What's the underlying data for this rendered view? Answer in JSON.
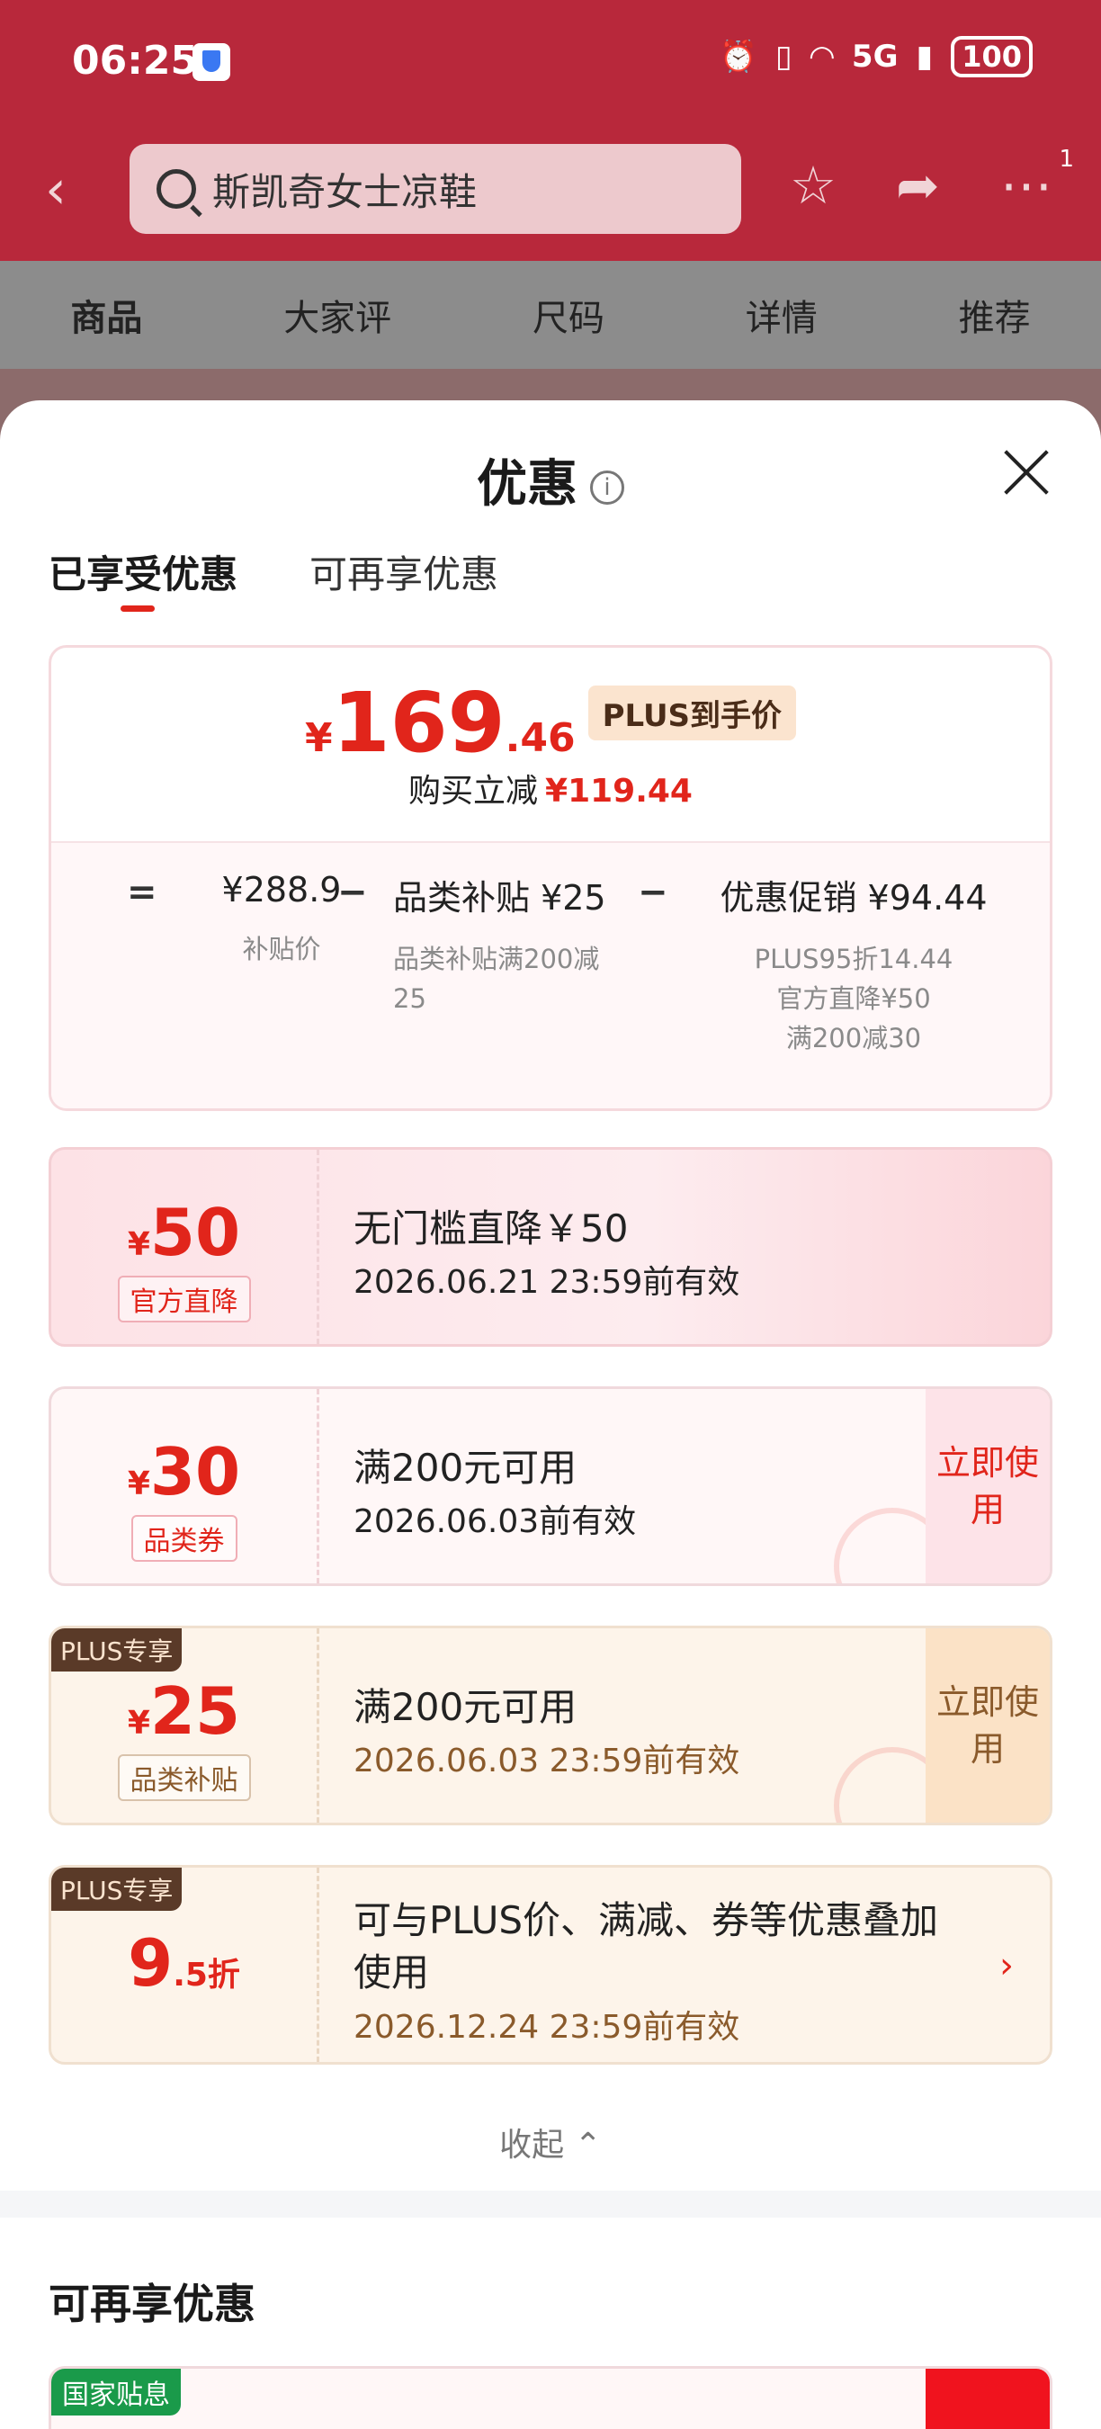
{
  "status_bar": {
    "time": "06:25",
    "network": "5G",
    "battery": "100"
  },
  "header": {
    "search_text": "斯凯奇女士凉鞋",
    "badge": "1",
    "tabs": [
      "商品",
      "大家评",
      "尺码",
      "详情",
      "推荐"
    ]
  },
  "sheet": {
    "title": "优惠",
    "subtabs": [
      "已享受优惠",
      "可再享优惠"
    ],
    "summary": {
      "yen": "¥",
      "price_int": "169",
      "price_dec": ".46",
      "plus_label": "PLUS到手价",
      "reduce_label": "购买立减",
      "reduce_amount": "¥119.44",
      "subsidy_price": "¥288.9",
      "subsidy_price_label": "补贴价",
      "category_subsidy": "品类补贴 ¥25",
      "category_subsidy_desc": "品类补贴满200减25",
      "promo": "优惠促销 ¥94.44",
      "promo_lines": [
        "PLUS95折14.44",
        "官方直降¥50",
        "满200减30"
      ]
    },
    "coupons": [
      {
        "yen": "¥",
        "amount": "50",
        "tag": "官方直降",
        "title": "无门槛直降￥50",
        "date": "2026.06.21 23:59前有效"
      },
      {
        "yen": "¥",
        "amount": "30",
        "tag": "品类券",
        "title": "满200元可用",
        "date": "2026.06.03前有效",
        "action": "立即使用"
      },
      {
        "corner": "PLUS专享",
        "yen": "¥",
        "amount": "25",
        "tag": "品类补贴",
        "title": "满200元可用",
        "date": "2026.06.03 23:59前有效",
        "action": "立即使用"
      },
      {
        "corner": "PLUS专享",
        "amount": "9",
        "suffix": ".5折",
        "title": "可与PLUS价、满减、券等优惠叠加使用",
        "date": "2026.12.24 23:59前有效"
      }
    ],
    "collapse_label": "收起",
    "more_title": "可再享优惠",
    "more_card_tag": "国家贴息"
  }
}
